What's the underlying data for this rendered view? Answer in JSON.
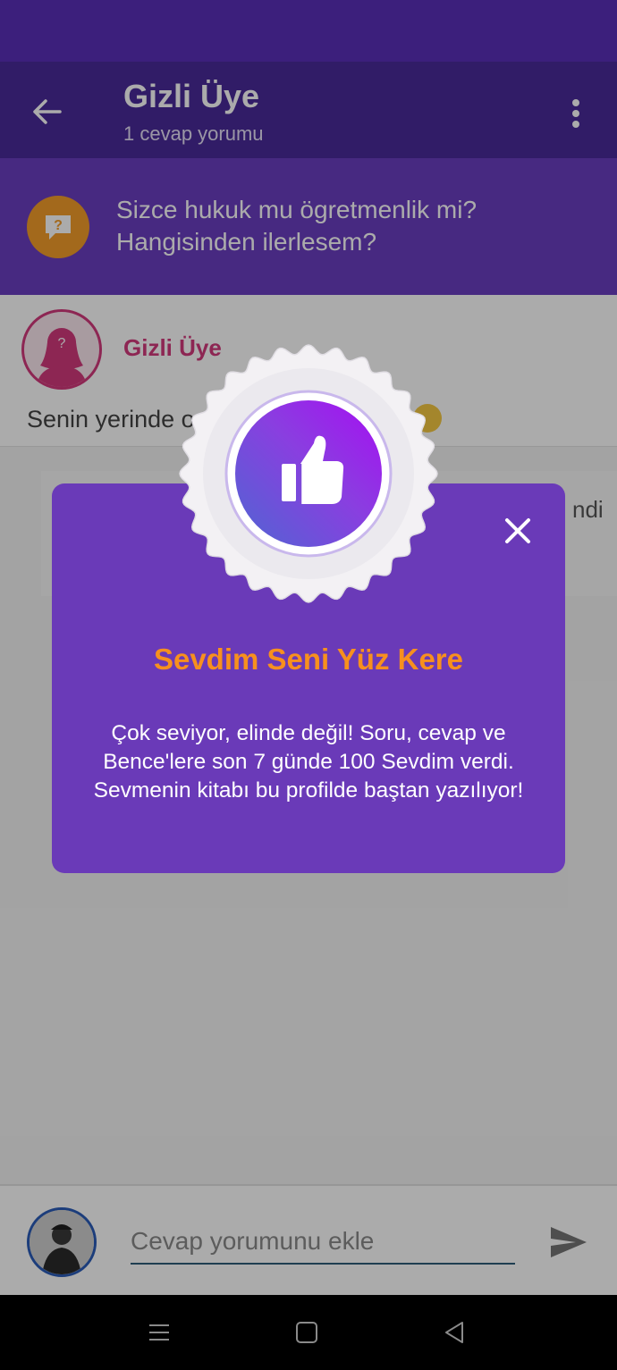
{
  "app_bar": {
    "title": "Gizli Üye",
    "subtitle": "1 cevap yorumu",
    "back_icon": "arrow-left-icon",
    "more_icon": "more-vertical-icon"
  },
  "question": {
    "icon": "question-bubble-icon",
    "text_line1": "Sizce hukuk mu ögretmenlik mi?",
    "text_line2": "Hangisinden ilerlesem?"
  },
  "answer": {
    "author": "Gizli Üye",
    "text_visible": "Senin yerinde o"
  },
  "comment": {
    "text_fragment": "ndi"
  },
  "modal": {
    "badge_icon": "thumbs-up-icon",
    "close_icon": "close-icon",
    "title": "Sevdim Seni Yüz Kere",
    "desc_line1": "Çok seviyor, elinde değil! Soru, cevap ve",
    "desc_line2": "Bence'lere son 7 günde 100 Sevdim verdi.",
    "desc_line3": "Sevmenin kitabı bu profilde baştan yazılıyor!"
  },
  "composer": {
    "placeholder": "Cevap yorumunu ekle",
    "value": "",
    "send_icon": "send-icon"
  },
  "nav": {
    "menu_icon": "menu-icon",
    "home_icon": "home-square-icon",
    "back_icon": "back-triangle-icon"
  },
  "colors": {
    "status_bar": "#5a2fba",
    "app_bar": "#4a2a9a",
    "question_bar": "#6a3ec0",
    "modal_bg": "#6a3ab8",
    "modal_title": "#f7901e",
    "author_pink": "#d23a7c",
    "question_icon_bg": "#f39d2b"
  }
}
